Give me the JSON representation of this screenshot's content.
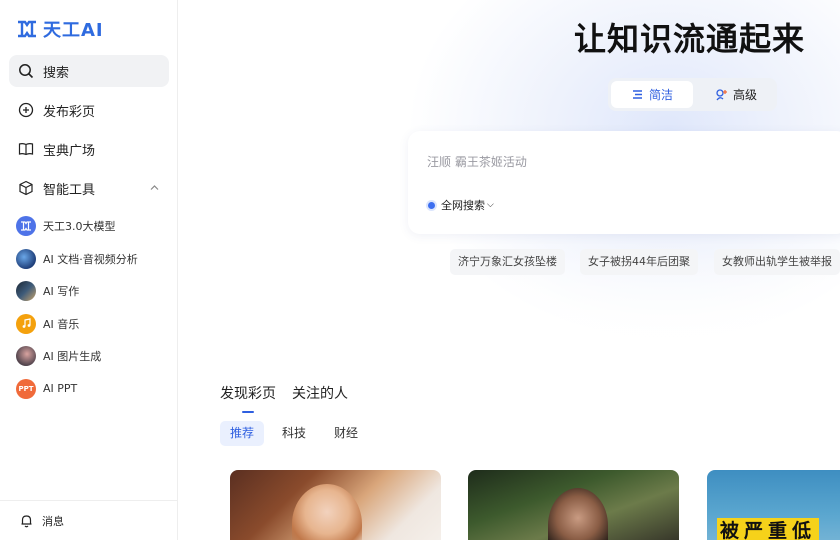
{
  "app": {
    "logo_text": "天工AI"
  },
  "sidebar": {
    "nav": [
      {
        "label": "搜索",
        "icon": "search-icon"
      },
      {
        "label": "发布彩页",
        "icon": "plus-circle-icon"
      },
      {
        "label": "宝典广场",
        "icon": "book-icon"
      },
      {
        "label": "智能工具",
        "icon": "cube-icon"
      }
    ],
    "tools": [
      {
        "label": "天工3.0大模型",
        "icon": "tiangong-model-icon",
        "color": "#4e73e8"
      },
      {
        "label": "AI 文档·音视频分析",
        "icon": "doc-analysis-icon",
        "color": "#1f3f7a"
      },
      {
        "label": "AI 写作",
        "icon": "writing-icon",
        "color": "#2b3a4f"
      },
      {
        "label": "AI 音乐",
        "icon": "music-icon",
        "color": "#f4a10d"
      },
      {
        "label": "AI 图片生成",
        "icon": "image-gen-icon",
        "color": "#5a4a52"
      },
      {
        "label": "AI PPT",
        "icon": "ppt-icon",
        "color": "#f06a3a",
        "badge": "PPT"
      }
    ],
    "bottom": {
      "label": "消息",
      "icon": "bell-icon"
    }
  },
  "hero": {
    "title": "让知识流通起来",
    "modes": {
      "simple": "简洁",
      "advanced": "高级",
      "selected": "简洁"
    },
    "search": {
      "placeholder": "汪顺 霸王茶姬活动",
      "scope": "全网搜索"
    },
    "hot": [
      "济宁万象汇女孩坠楼",
      "女子被拐44年后团聚",
      "女教师出轨学生被举报"
    ]
  },
  "feed": {
    "tabs": [
      "发现彩页",
      "关注的人"
    ],
    "active_tab": "发现彩页",
    "categories": [
      "推荐",
      "科技",
      "财经"
    ],
    "active_category": "推荐",
    "cards": [
      {
        "type": "portrait-photo"
      },
      {
        "type": "portrait-photo"
      },
      {
        "type": "news-photo",
        "caption": "被严重低"
      }
    ]
  },
  "colors": {
    "accent": "#2f5fe0",
    "brand": "#2f6bdf",
    "chip_bg": "#f4f5f7"
  }
}
